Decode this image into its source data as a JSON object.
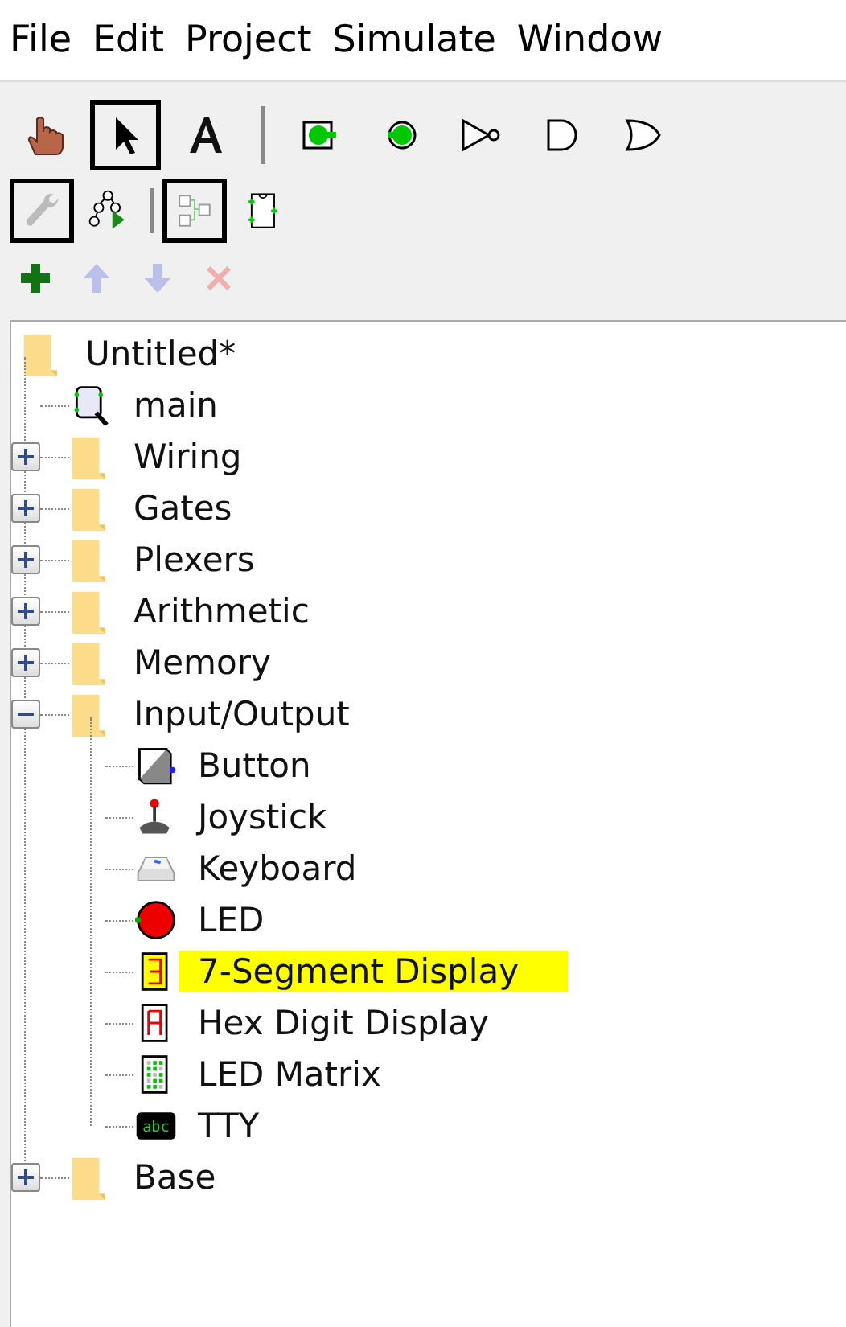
{
  "menu_bar": [
    "File",
    "Edit",
    "Project",
    "Simulate",
    "Window"
  ],
  "toolbar": [
    {
      "kind": "hand",
      "selected": false
    },
    {
      "kind": "arrow",
      "selected": true
    },
    {
      "kind": "text",
      "selected": false
    },
    {
      "kind": "separator"
    },
    {
      "kind": "input-pin",
      "selected": false
    },
    {
      "kind": "output-pin",
      "selected": false
    },
    {
      "kind": "not-gate",
      "selected": false
    },
    {
      "kind": "and-gate",
      "selected": false
    },
    {
      "kind": "or-gate",
      "selected": false
    }
  ],
  "view_toolbar": [
    {
      "kind": "wrench",
      "selected": true
    },
    {
      "kind": "tree",
      "selected": false
    },
    {
      "kind": "separator"
    },
    {
      "kind": "layout",
      "selected": true
    },
    {
      "kind": "appearance",
      "selected": false
    }
  ],
  "explorer_toolbar": [
    {
      "kind": "add",
      "disabled": false
    },
    {
      "kind": "up",
      "disabled": true
    },
    {
      "kind": "down",
      "disabled": true
    },
    {
      "kind": "delete",
      "disabled": true
    }
  ],
  "tree": {
    "label": "Untitled*",
    "kind": "folder",
    "children": [
      {
        "label": "main",
        "kind": "circuit"
      },
      {
        "label": "Wiring",
        "kind": "folder",
        "expanded": false
      },
      {
        "label": "Gates",
        "kind": "folder",
        "expanded": false
      },
      {
        "label": "Plexers",
        "kind": "folder",
        "expanded": false
      },
      {
        "label": "Arithmetic",
        "kind": "folder",
        "expanded": false
      },
      {
        "label": "Memory",
        "kind": "folder",
        "expanded": false
      },
      {
        "label": "Input/Output",
        "kind": "folder",
        "expanded": true,
        "children": [
          {
            "label": "Button",
            "kind": "button"
          },
          {
            "label": "Joystick",
            "kind": "joystick"
          },
          {
            "label": "Keyboard",
            "kind": "keyboard"
          },
          {
            "label": "LED",
            "kind": "led"
          },
          {
            "label": "7-Segment Display",
            "kind": "seven-segment",
            "highlighted": true
          },
          {
            "label": "Hex Digit Display",
            "kind": "hex-digit"
          },
          {
            "label": "LED Matrix",
            "kind": "led-matrix"
          },
          {
            "label": "TTY",
            "kind": "tty",
            "icon_text": "abc"
          }
        ]
      },
      {
        "label": "Base",
        "kind": "folder",
        "expanded": false
      }
    ]
  }
}
